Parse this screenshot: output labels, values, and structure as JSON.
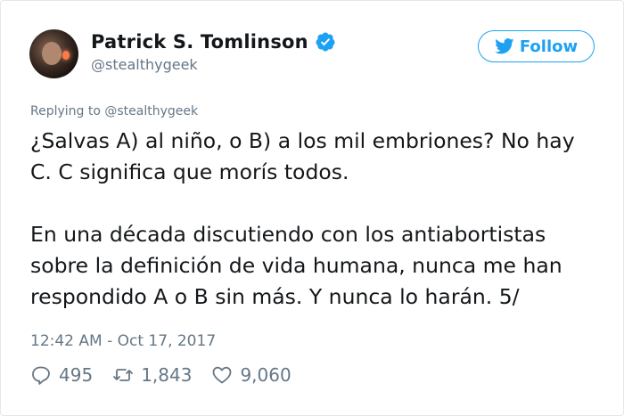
{
  "author": {
    "display_name": "Patrick S. Tomlinson",
    "handle": "@stealthygeek",
    "verified_icon": "verified-badge-icon"
  },
  "follow_button": {
    "label": "Follow",
    "icon": "twitter-bird-icon",
    "color": "#1da1f2"
  },
  "tweet": {
    "replying_to": "Replying to @stealthygeek",
    "lines": [
      "¿Salvas A) al niño, o B) a los mil embriones? No hay",
      "C. C significa que morís todos.",
      "En una década discutiendo con los antiabortistas",
      "sobre la definición de vida humana, nunca me han",
      "respondido A o B sin más. Y nunca lo harán. 5/"
    ],
    "timestamp": "12:42 AM - Oct 17, 2017"
  },
  "actions": {
    "replies": "495",
    "retweets": "1,843",
    "likes": "9,060"
  }
}
